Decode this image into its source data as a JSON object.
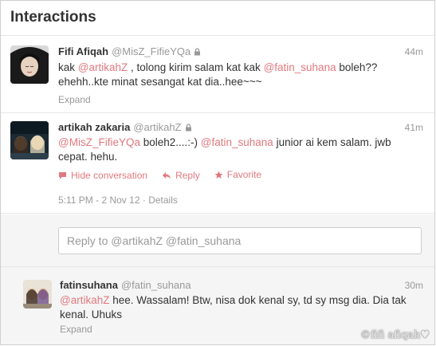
{
  "header": {
    "title": "Interactions"
  },
  "tweets": [
    {
      "name": "Fifi Afiqah",
      "handle": "@MisZ_FifieYQa",
      "time": "44m",
      "line1_pre": "kak ",
      "line1_mention1": "@artikahZ",
      "line1_mid": " , tolong kirim salam kat kak ",
      "line1_mention2": "@fatin_suhana",
      "line1_post": " boleh??",
      "line2": "ehehh..kte minat sesangat kat dia..hee~~~",
      "expand": "Expand"
    },
    {
      "name": "artikah zakaria",
      "handle": "@artikahZ",
      "time": "41m",
      "line1_mention1": "@MisZ_FifieYQa",
      "line1_mid": " boleh2....:-) ",
      "line1_mention2": "@fatin_suhana",
      "line1_post": " junior ai kem salam. jwb",
      "line2": "cepat. hehu.",
      "hide_label": "Hide conversation",
      "reply_label": "Reply",
      "favorite_label": "Favorite",
      "timestamp": "5:11 PM - 2 Nov 12",
      "separator": "·",
      "details": "Details"
    }
  ],
  "reply_box": {
    "placeholder": "Reply to @artikahZ @fatin_suhana"
  },
  "reply_tweet": {
    "name": "fatinsuhana",
    "handle": "@fatin_suhana",
    "time": "30m",
    "mention": "@artikahZ",
    "line1_post": " hee. Wassalam! Btw, nisa dok kenal sy, td sy msg dia. Dia tak",
    "line2": "kenal. Uhuks",
    "expand": "Expand"
  },
  "watermark": "©fifi afiqah♥",
  "colors": {
    "mention": "#e0797f",
    "muted": "#999999",
    "text": "#333333",
    "background_alt": "#f5f5f5"
  }
}
